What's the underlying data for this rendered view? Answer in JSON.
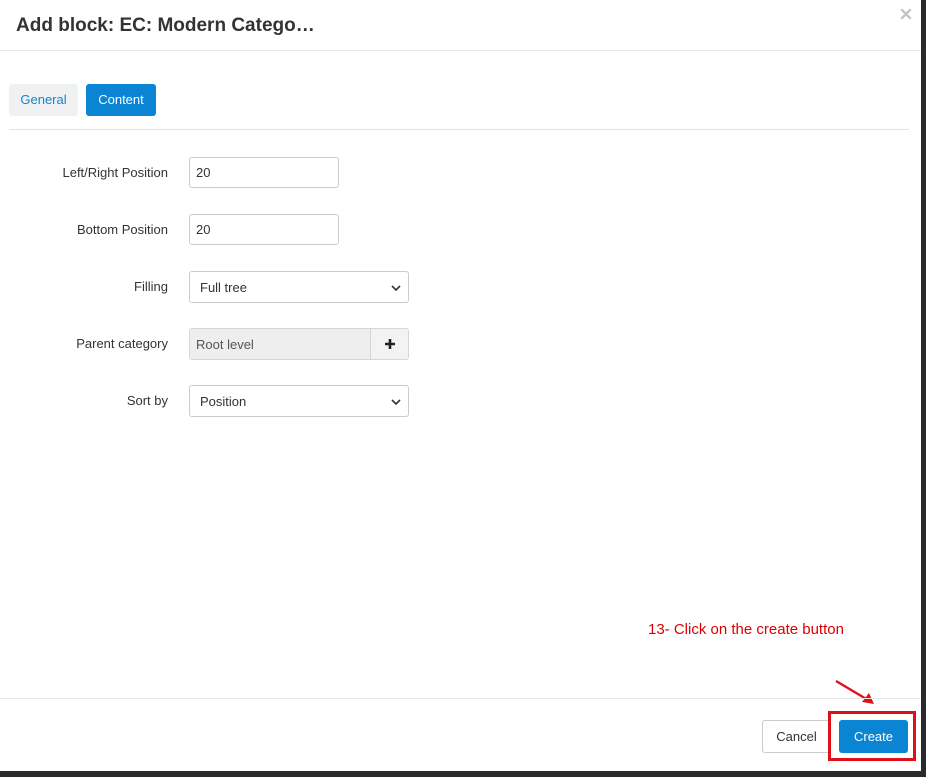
{
  "dialog": {
    "title": "Add block: EC: Modern Catego…",
    "close_icon": "close-icon"
  },
  "tabs": [
    {
      "label": "General",
      "active": false
    },
    {
      "label": "Content",
      "active": true
    }
  ],
  "form": {
    "left_right_position": {
      "label": "Left/Right Position",
      "value": "20"
    },
    "bottom_position": {
      "label": "Bottom Position",
      "value": "20"
    },
    "filling": {
      "label": "Filling",
      "value": "Full tree"
    },
    "parent_category": {
      "label": "Parent category",
      "value": "Root level",
      "add_icon": "plus-icon"
    },
    "sort_by": {
      "label": "Sort by",
      "value": "Position"
    }
  },
  "annotation": {
    "text": "13- Click on the create button",
    "color": "#dd0000"
  },
  "footer": {
    "cancel_label": "Cancel",
    "create_label": "Create"
  },
  "colors": {
    "accent": "#0a85d3",
    "highlight": "#e0101a"
  }
}
